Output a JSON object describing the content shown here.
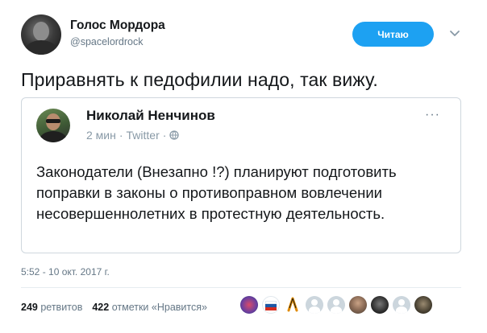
{
  "author": {
    "name": "Голос Мордора",
    "handle": "@spacelordrock",
    "avatar_icon": "profile-photo-dark"
  },
  "follow_button": {
    "label": "Читаю",
    "color": "#1da1f2"
  },
  "tweet": {
    "text": "Приравнять к педофилии надо, так вижу."
  },
  "quoted_tweet": {
    "author_name": "Николай Ненчинов",
    "time": "2 мин",
    "source": "Twitter",
    "separator": "·",
    "more_label": "···",
    "text": "Законодатели (Внезапно !?) планируют подготовить поправки в законы о противоправном вовлечении несовершеннолетних в протестную деятельность."
  },
  "timestamp": "5:52 - 10 окт. 2017 г.",
  "stats": {
    "retweets_count": "249",
    "retweets_label": "ретвитов",
    "likes_count": "422",
    "likes_label": "отметки «Нравится»"
  },
  "colors": {
    "accent": "#1da1f2",
    "text": "#14171a",
    "secondary": "#657786",
    "border": "#cfd7de"
  }
}
